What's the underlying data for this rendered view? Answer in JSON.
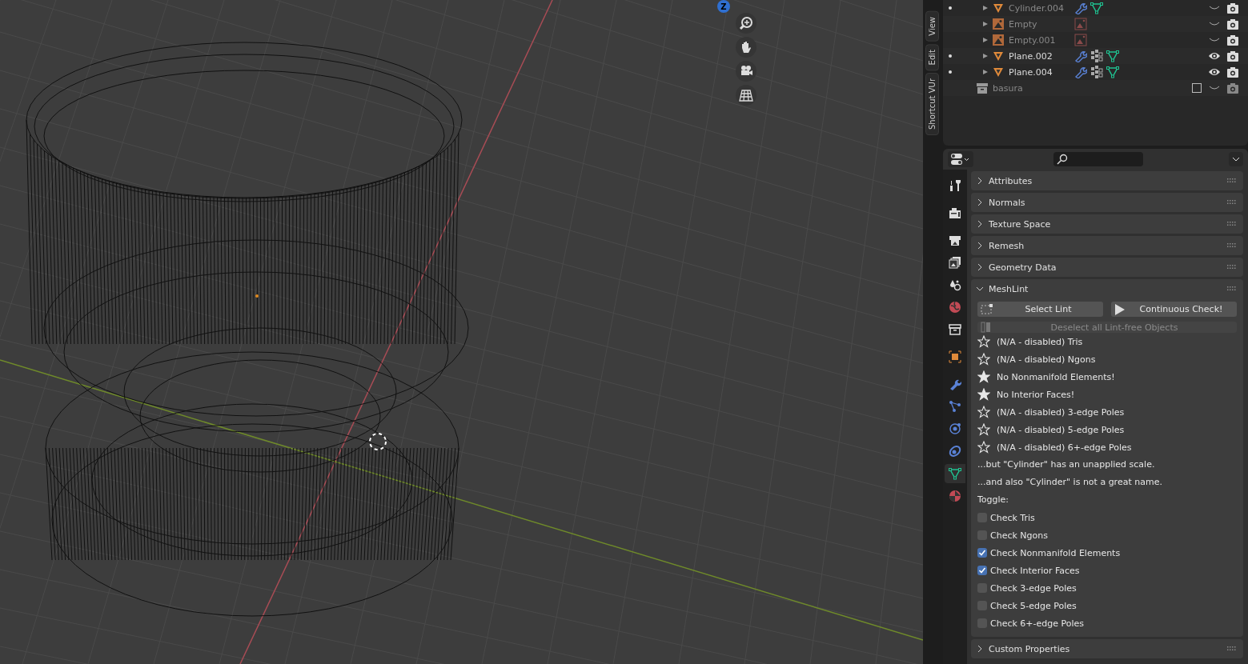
{
  "viewport": {
    "gizmo_axis_label": "Z"
  },
  "sidebar_tabs": [
    {
      "label": "View"
    },
    {
      "label": "Edit"
    },
    {
      "label": "Shortcut VUr"
    }
  ],
  "outliner": {
    "rows": [
      {
        "name": "Cylinder.004",
        "kind": "mesh",
        "dot": true,
        "dimmed": true,
        "visible": false,
        "icons": [
          {
            "kind": "modifier"
          },
          {
            "kind": "mesh_data"
          }
        ]
      },
      {
        "name": "Empty",
        "kind": "empty",
        "dot": false,
        "dimmed": true,
        "visible": false,
        "icons": [
          {
            "kind": "image_data"
          }
        ]
      },
      {
        "name": "Empty.001",
        "kind": "empty",
        "dot": false,
        "dimmed": true,
        "visible": false,
        "icons": [
          {
            "kind": "image_data"
          }
        ]
      },
      {
        "name": "Plane.002",
        "kind": "mesh",
        "dot": true,
        "dimmed": false,
        "visible": true,
        "icons": [
          {
            "kind": "modifier"
          },
          {
            "kind": "instancer"
          },
          {
            "kind": "mesh_data"
          }
        ]
      },
      {
        "name": "Plane.004",
        "kind": "mesh",
        "dot": true,
        "dimmed": false,
        "visible": true,
        "icons": [
          {
            "kind": "modifier"
          },
          {
            "kind": "instancer"
          },
          {
            "kind": "mesh_data"
          }
        ]
      },
      {
        "name": "basura",
        "kind": "collection",
        "dot": false,
        "dimmed": true,
        "visible": false,
        "checked": false
      }
    ]
  },
  "properties": {
    "tabs": [
      {
        "kind": "tool",
        "selected": false
      },
      {
        "kind": "render",
        "selected": false
      },
      {
        "kind": "output",
        "selected": false
      },
      {
        "kind": "view_layer",
        "selected": false
      },
      {
        "kind": "scene",
        "selected": false
      },
      {
        "kind": "world",
        "selected": false
      },
      {
        "kind": "collection",
        "selected": false
      },
      {
        "kind": "object",
        "selected": false
      },
      {
        "kind": "modifier",
        "selected": false
      },
      {
        "kind": "particles",
        "selected": false
      },
      {
        "kind": "physics",
        "selected": false
      },
      {
        "kind": "constraints",
        "selected": false
      },
      {
        "kind": "data",
        "selected": true
      },
      {
        "kind": "material",
        "selected": false
      }
    ],
    "panels": [
      {
        "title": "Attributes",
        "expanded": false
      },
      {
        "title": "Normals",
        "expanded": false
      },
      {
        "title": "Texture Space",
        "expanded": false
      },
      {
        "title": "Remesh",
        "expanded": false
      },
      {
        "title": "Geometry Data",
        "expanded": false
      },
      {
        "title": "MeshLint",
        "expanded": true,
        "kind": "meshlint"
      },
      {
        "title": "Custom Properties",
        "expanded": false
      }
    ]
  },
  "meshlint": {
    "buttons": [
      {
        "label": "Select Lint",
        "kind": "select"
      },
      {
        "label": "Continuous Check!",
        "kind": "play"
      }
    ],
    "deselect_button": {
      "label": "Deselect all Lint-free Objects",
      "disabled": true
    },
    "results": [
      {
        "text": "(N/A - disabled) Tris",
        "passed": false
      },
      {
        "text": "(N/A - disabled) Ngons",
        "passed": false
      },
      {
        "text": "No Nonmanifold Elements!",
        "passed": true
      },
      {
        "text": "No Interior Faces!",
        "passed": true
      },
      {
        "text": "(N/A - disabled) 3-edge Poles",
        "passed": false
      },
      {
        "text": "(N/A - disabled) 5-edge Poles",
        "passed": false
      },
      {
        "text": "(N/A - disabled) 6+-edge Poles",
        "passed": false
      }
    ],
    "notes": [
      "...but \"Cylinder\" has an unapplied scale.",
      "...and also \"Cylinder\" is not a great name."
    ],
    "toggle_label": "Toggle:",
    "toggles": [
      {
        "label": "Check Tris",
        "checked": false
      },
      {
        "label": "Check Ngons",
        "checked": false
      },
      {
        "label": "Check Nonmanifold Elements",
        "checked": true
      },
      {
        "label": "Check Interior Faces",
        "checked": true
      },
      {
        "label": "Check 3-edge Poles",
        "checked": false
      },
      {
        "label": "Check 5-edge Poles",
        "checked": false
      },
      {
        "label": "Check 6+-edge Poles",
        "checked": false
      }
    ]
  }
}
